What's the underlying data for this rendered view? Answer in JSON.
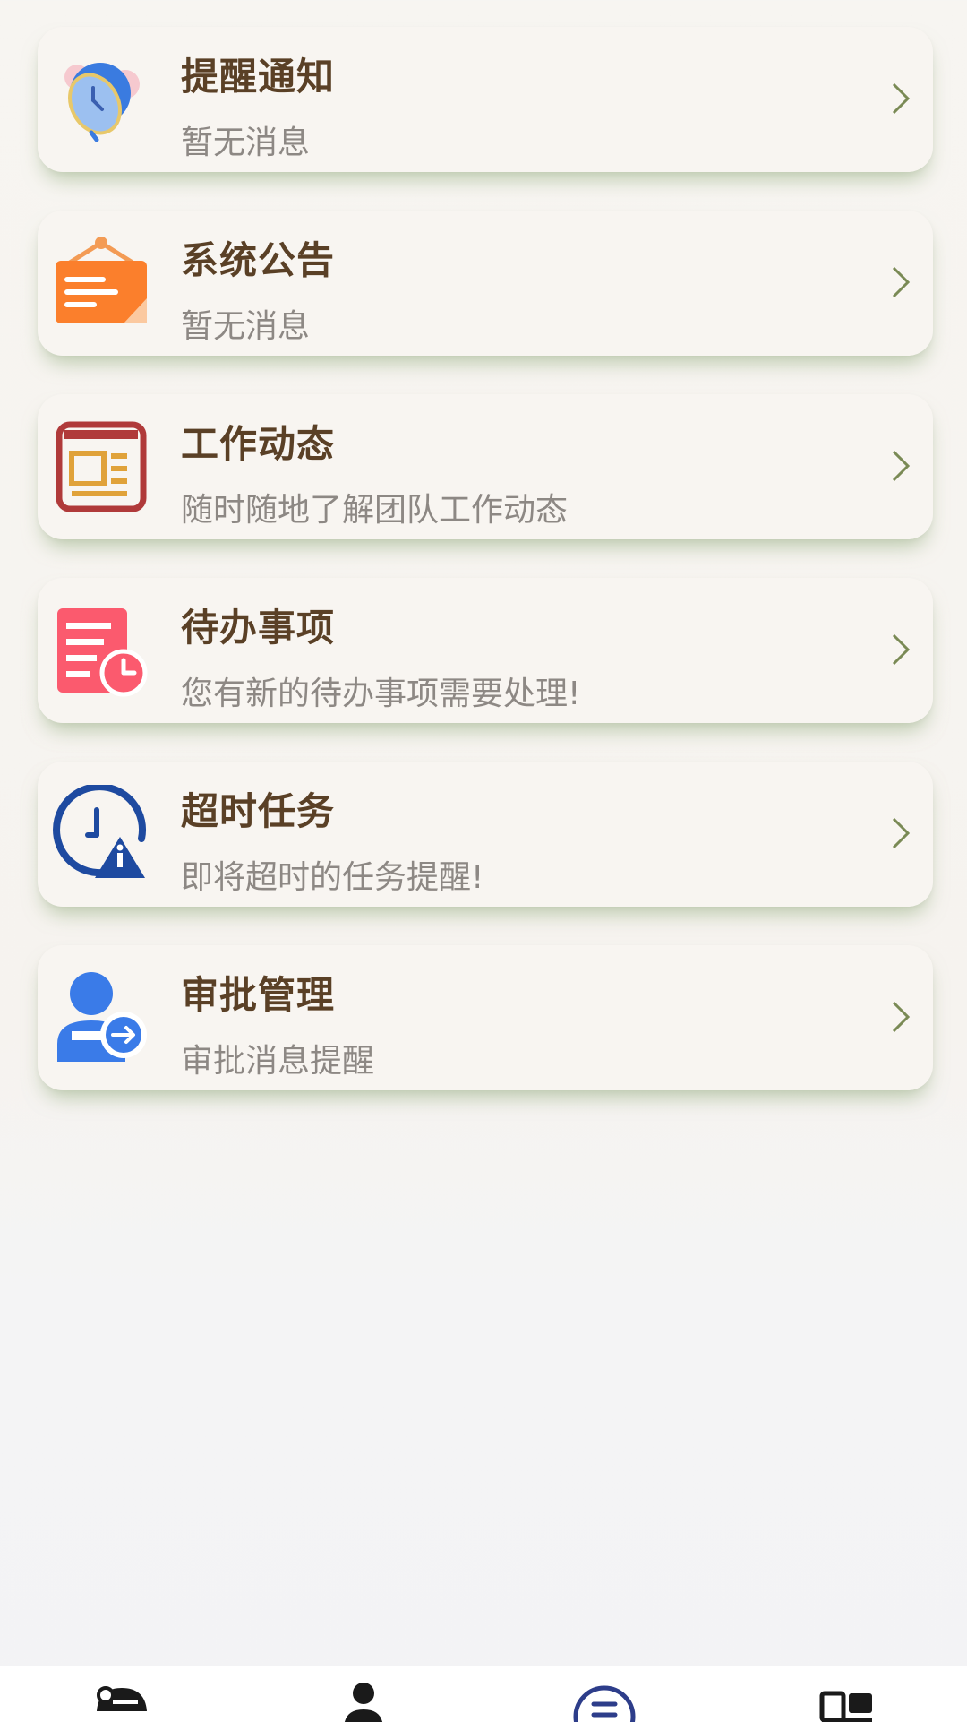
{
  "items": [
    {
      "id": "reminder",
      "title": "提醒通知",
      "subtitle": "暂无消息",
      "icon": "alarm-clock-icon"
    },
    {
      "id": "announcement",
      "title": "系统公告",
      "subtitle": "暂无消息",
      "icon": "signboard-icon"
    },
    {
      "id": "work-activity",
      "title": "工作动态",
      "subtitle": "随时随地了解团队工作动态",
      "icon": "news-icon"
    },
    {
      "id": "todo",
      "title": "待办事项",
      "subtitle": "您有新的待办事项需要处理!",
      "icon": "todo-list-icon"
    },
    {
      "id": "overdue",
      "title": "超时任务",
      "subtitle": "即将超时的任务提醒!",
      "icon": "clock-warning-icon"
    },
    {
      "id": "approval",
      "title": "审批管理",
      "subtitle": "审批消息提醒",
      "icon": "approval-user-icon"
    }
  ],
  "tabbar": [
    {
      "icon": "home-icon"
    },
    {
      "icon": "user-icon"
    },
    {
      "icon": "message-icon",
      "active": true
    },
    {
      "icon": "grid-icon"
    }
  ],
  "colors": {
    "title": "#5a4026",
    "subtitle": "#8d8884",
    "card": "#f8f5f1",
    "chevron": "#7a8a55",
    "active_tab": "#2d3d8a"
  }
}
